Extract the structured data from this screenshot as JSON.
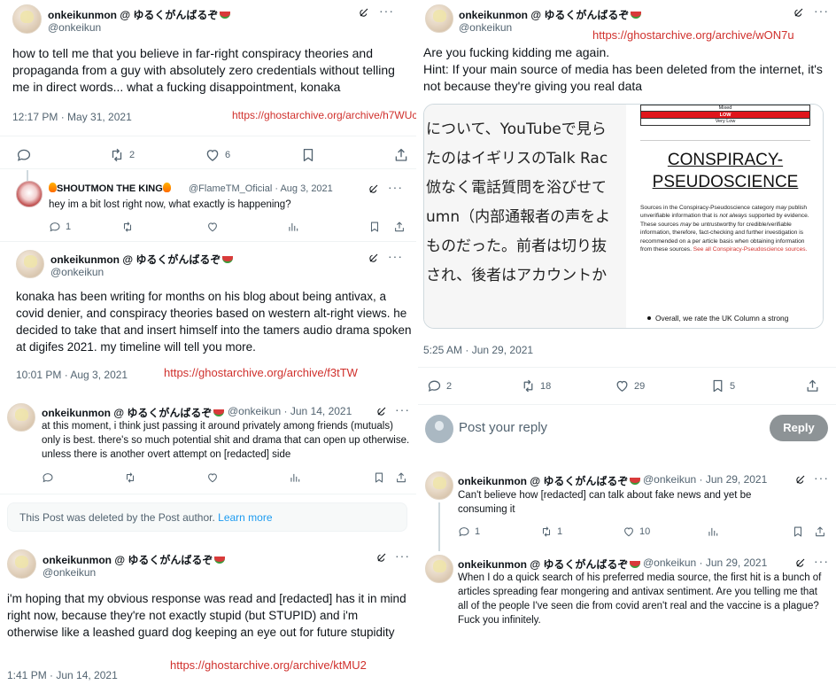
{
  "panel1": {
    "name": "onkeikunmon @ ゆるくがんばるぞ",
    "handle": "@onkeikun",
    "text": "how to tell me that you believe in far-right conspiracy theories and propaganda from a guy with absolutely zero credentials without telling me in direct words... what a fucking disappointment, konaka",
    "time": "12:17 PM · May 31, 2021",
    "archive": "https://ghostarchive.org/archive/h7WUc",
    "retweets": "2",
    "likes": "6",
    "reply": {
      "name": "SHOUTMON THE KING",
      "handle": "@FlameTM_Oficial · Aug 3, 2021",
      "text": "hey im a bit lost right now, what exactly is happening?",
      "replies": "1"
    },
    "follow": {
      "name": "onkeikunmon @ ゆるくがんばるぞ",
      "handle": "@onkeikun",
      "text": "konaka has been writing for months on his blog about being antivax, a covid denier, and conspiracy theories based on western alt-right views. he decided to take that and insert himself into the tamers audio drama spoken at digifes 2021. my timeline will tell you more.",
      "time": "10:01 PM · Aug 3, 2021",
      "archive": "https://ghostarchive.org/archive/f3tTW"
    }
  },
  "panel2": {
    "name": "onkeikunmon @ ゆるくがんばるぞ",
    "handle": "@onkeikun · Jun 14, 2021",
    "text": "at this moment, i think just passing it around privately among friends (mutuals) only is best. there's so much potential shit and drama that can open up otherwise. unless there is another overt attempt on [redacted] side",
    "deleted_text": "This Post was deleted by the Post author.",
    "learn_more": "Learn more"
  },
  "panel3": {
    "name": "onkeikunmon @ ゆるくがんばるぞ",
    "handle": "@onkeikun",
    "text": "i'm hoping that my obvious response was read and [redacted] has it in mind right now, because they're not exactly stupid (but STUPID) and i'm otherwise like a leashed guard dog keeping an eye out for future stupidity",
    "time": "1:41 PM · Jun 14, 2021",
    "archive": "https://ghostarchive.org/archive/ktMU2"
  },
  "panel4": {
    "name": "onkeikunmon @ ゆるくがんばるぞ",
    "handle": "@onkeikun",
    "archive": "https://ghostarchive.org/archive/wON7u",
    "text_line1": "Are you fucking kidding me again.",
    "text_line2": "Hint: If your main source of media has been deleted from the internet, it's not because they're giving you real data",
    "jp_lines": [
      "について、YouTubeで見ら",
      "たのはイギリスのTalk Rac",
      "倣なく電話質問を浴びせて",
      "umn（内部通報者の声をよ",
      "ものだった。前者は切り抜",
      "され、後者はアカウントか"
    ],
    "rating": {
      "mixed": "Mixed",
      "low": "LOW",
      "very_low": "Very Low"
    },
    "heading": "CONSPIRACY-PSEUDOSCIENCE",
    "heading_line1": "CONSPIRACY-",
    "heading_line2": "PSEUDOSCIENCE",
    "desc_1": "Sources in the Conspiracy-Pseudoscience category ",
    "desc_may": "may",
    "desc_2": " publish unverifiable information that is ",
    "desc_not_always": "not always",
    "desc_3": " supported by evidence. These sources ",
    "desc_may2": "may",
    "desc_4": " be untrustworthy for credible/verifiable information, therefore, fact-checking and further investigation is recommended on a per article basis when obtaining information from these sources. ",
    "desc_link": "See all Conspiracy-Pseudoscience sources.",
    "bullet": "Overall, we rate the UK Column a strong",
    "time": "5:25 AM · Jun 29, 2021",
    "replies": "2",
    "retweets": "18",
    "likes": "29",
    "bookmarks": "5",
    "reply_placeholder": "Post your reply",
    "reply_button": "Reply"
  },
  "panel5": {
    "t1": {
      "name": "onkeikunmon @ ゆるくがんばるぞ",
      "handle": "@onkeikun · Jun 29, 2021",
      "text": "Can't believe how [redacted] can talk about fake news and yet be consuming it",
      "replies": "1",
      "retweets": "1",
      "likes": "10"
    },
    "t2": {
      "name": "onkeikunmon @ ゆるくがんばるぞ",
      "handle": "@onkeikun · Jun 29, 2021",
      "text": "When I do a quick search of his preferred media source, the first hit is a bunch of articles spreading fear mongering and antivax sentiment. Are you telling me that all of the people I've seen die from covid aren't real and the vaccine is a plague? Fuck you infinitely."
    }
  },
  "colors": {
    "archive_link": "#d0312d",
    "accent": "#1d9bf0",
    "muted": "#536471",
    "low_rating": "#e0161c"
  }
}
